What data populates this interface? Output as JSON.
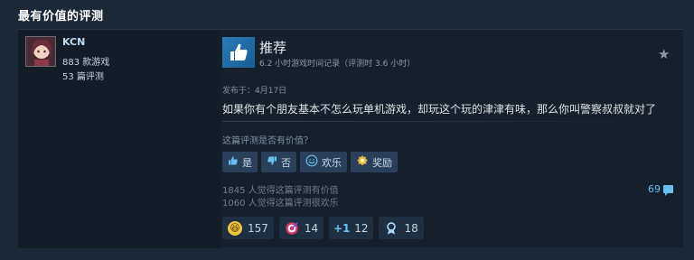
{
  "section": {
    "title": "最有价值的评测"
  },
  "author": {
    "name": "KCN",
    "games_owned": "883 款游戏",
    "reviews": "53 篇评测"
  },
  "review": {
    "verdict": "推荐",
    "playtime": "6.2 小时游戏时间记录（评测时 3.6 小时）",
    "posted": "发布于：4月17日",
    "text": "如果你有个朋友基本不怎么玩单机游戏，却玩这个玩的津津有味，那么你叫警察叔叔就对了"
  },
  "feedback": {
    "question": "这篇评测是否有价值？",
    "yes_label": "是",
    "no_label": "否",
    "funny_label": "欢乐",
    "award_label": "奖励"
  },
  "stats": {
    "helpful": "1845 人觉得这篇评测有价值",
    "funny": "1060 人觉得这篇评测很欢乐",
    "comments": "69"
  },
  "awards": [
    {
      "icon": "laughing-emoji-icon",
      "count": "157"
    },
    {
      "icon": "target-icon",
      "count": "14"
    },
    {
      "icon": "plus-one-icon",
      "count": "12"
    },
    {
      "icon": "ribbon-medal-icon",
      "count": "18"
    }
  ],
  "colors": {
    "background": "#1b2838",
    "card": "#15202c",
    "accent": "#66c0f4",
    "button": "#2a3f5a"
  }
}
